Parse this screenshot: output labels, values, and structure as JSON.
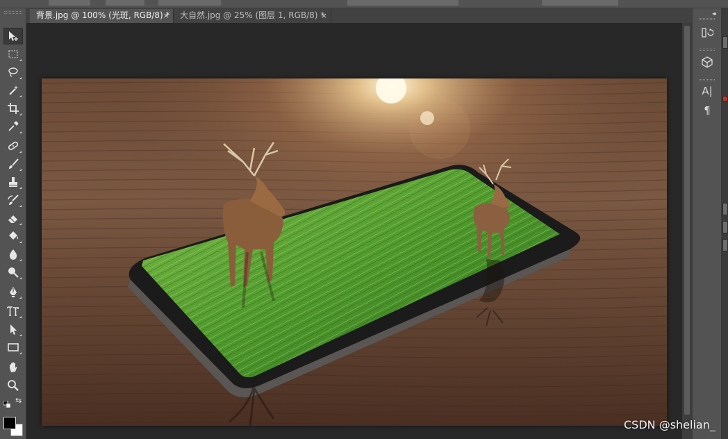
{
  "tabs": [
    {
      "label": "背景.jpg @ 100% (光斑, RGB/8) *",
      "close": "×"
    },
    {
      "label": "大自然.jpg @ 25% (图层 1, RGB/8) *",
      "close": "×"
    }
  ],
  "toolbar": {
    "tools": [
      {
        "name": "move-tool",
        "icon": "move-icon"
      },
      {
        "name": "marquee-tool",
        "icon": "rect-marquee-icon"
      },
      {
        "name": "lasso-tool",
        "icon": "lasso-icon"
      },
      {
        "name": "magic-wand-tool",
        "icon": "magic-wand-icon"
      },
      {
        "name": "crop-tool",
        "icon": "crop-icon"
      },
      {
        "name": "eyedropper-tool",
        "icon": "eyedropper-icon"
      },
      {
        "name": "healing-brush-tool",
        "icon": "bandage-icon"
      },
      {
        "name": "brush-tool",
        "icon": "brush-icon"
      },
      {
        "name": "clone-stamp-tool",
        "icon": "stamp-icon"
      },
      {
        "name": "history-brush-tool",
        "icon": "history-brush-icon"
      },
      {
        "name": "eraser-tool",
        "icon": "eraser-icon"
      },
      {
        "name": "paint-bucket-tool",
        "icon": "bucket-icon"
      },
      {
        "name": "blur-tool",
        "icon": "drop-icon"
      },
      {
        "name": "dodge-tool",
        "icon": "dodge-icon"
      },
      {
        "name": "pen-tool",
        "icon": "pen-icon"
      },
      {
        "name": "type-tool",
        "icon": "type-icon"
      },
      {
        "name": "path-selection-tool",
        "icon": "arrow-icon"
      },
      {
        "name": "shape-tool",
        "icon": "rectangle-icon"
      },
      {
        "name": "hand-tool",
        "icon": "hand-icon"
      },
      {
        "name": "zoom-tool",
        "icon": "zoom-icon"
      }
    ],
    "foreground_color": "#000000",
    "background_color": "#ffffff"
  },
  "dock": {
    "buttons": [
      {
        "name": "history-panel-button",
        "icon": "history-icon"
      },
      {
        "name": "3d-panel-button",
        "icon": "cube-icon"
      },
      {
        "name": "character-panel-button",
        "icon": "character-icon",
        "text": "A|"
      },
      {
        "name": "paragraph-panel-button",
        "icon": "pilcrow-icon",
        "text": "¶"
      }
    ]
  },
  "canvas": {
    "image": "deer-on-phone-artwork"
  },
  "watermark": "CSDN @shelian_"
}
